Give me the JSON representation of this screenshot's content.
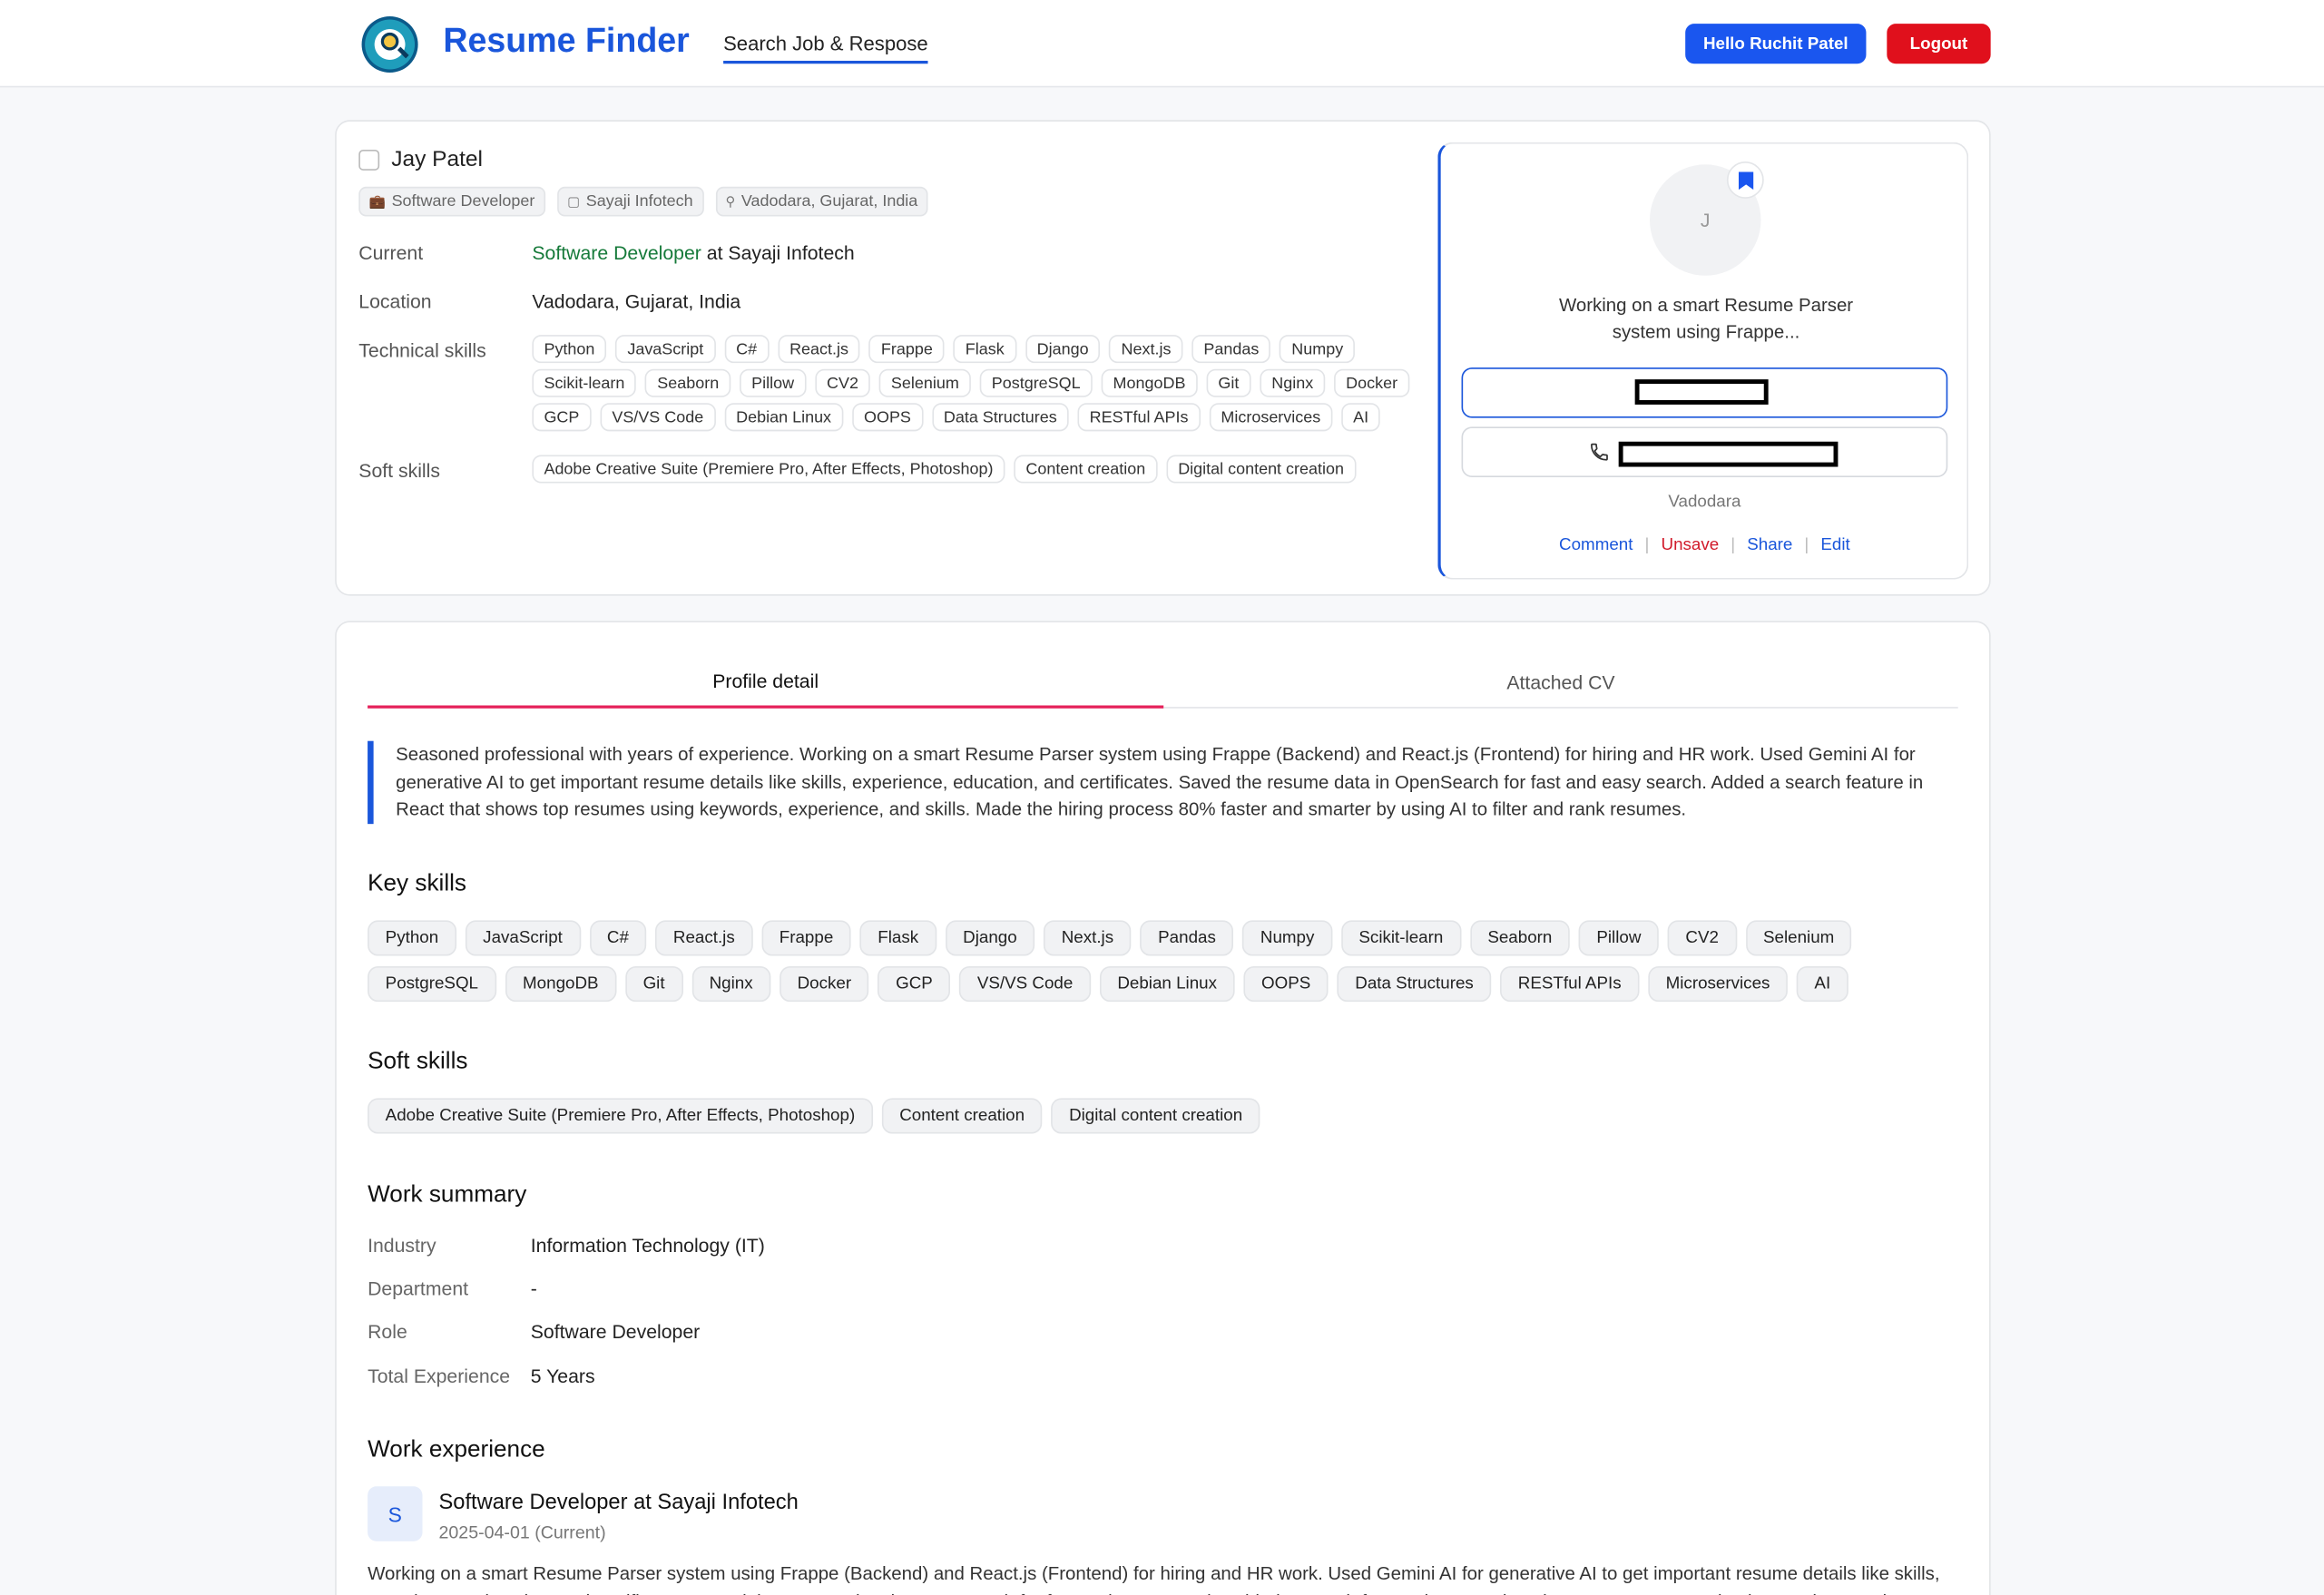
{
  "header": {
    "brand": "Resume Finder",
    "nav_link": "Search Job & Respose",
    "hello_button": "Hello Ruchit Patel",
    "logout_button": "Logout"
  },
  "candidate": {
    "name": "Jay Patel",
    "chips": {
      "role": "Software Developer",
      "company": "Sayaji Infotech",
      "location": "Vadodara, Gujarat, India"
    },
    "current_label": "Current",
    "current_role": "Software Developer",
    "current_sep": " at ",
    "current_company": "Sayaji Infotech",
    "location_label": "Location",
    "location_value": "Vadodara, Gujarat, India",
    "tech_label": "Technical skills",
    "tech_skills": [
      "Python",
      "JavaScript",
      "C#",
      "React.js",
      "Frappe",
      "Flask",
      "Django",
      "Next.js",
      "Pandas",
      "Numpy",
      "Scikit-learn",
      "Seaborn",
      "Pillow",
      "CV2",
      "Selenium",
      "PostgreSQL",
      "MongoDB",
      "Git",
      "Nginx",
      "Docker",
      "GCP",
      "VS/VS Code",
      "Debian Linux",
      "OOPS",
      "Data Structures",
      "RESTful APIs",
      "Microservices",
      "AI"
    ],
    "soft_label": "Soft skills",
    "soft_skills": [
      "Adobe Creative Suite (Premiere Pro, After Effects, Photoshop)",
      "Content creation",
      "Digital content creation"
    ]
  },
  "panel": {
    "avatar_initial": "J",
    "description": "Working on a smart Resume Parser system using Frappe...",
    "city": "Vadodara",
    "actions": {
      "comment": "Comment",
      "unsave": "Unsave",
      "share": "Share",
      "edit": "Edit"
    }
  },
  "tabs": {
    "profile": "Profile detail",
    "cv": "Attached CV"
  },
  "profile": {
    "summary": "Seasoned professional with years of experience. Working on a smart Resume Parser system using Frappe (Backend) and React.js (Frontend) for hiring and HR work. Used Gemini AI for generative AI to get important resume details like skills, experience, education, and certificates. Saved the resume data in OpenSearch for fast and easy search. Added a search feature in React that shows top resumes using keywords, experience, and skills. Made the hiring process 80% faster and smarter by using AI to filter and rank resumes.",
    "key_skills_heading": "Key skills",
    "soft_skills_heading": "Soft skills",
    "work_summary_heading": "Work summary",
    "work_summary": {
      "industry_label": "Industry",
      "industry": "Information Technology (IT)",
      "department_label": "Department",
      "department": "-",
      "role_label": "Role",
      "role": "Software Developer",
      "experience_label": "Total Experience",
      "experience": "5 Years"
    },
    "work_experience_heading": "Work experience",
    "experience": {
      "initial": "S",
      "title": "Software Developer at Sayaji Infotech",
      "date": "2025-04-01 (Current)",
      "description": "Working on a smart Resume Parser system using Frappe (Backend) and React.js (Frontend) for hiring and HR work. Used Gemini AI for generative AI to get important resume details like skills, experience, education, and certificates. Saved the resume data in OpenSearch for fast and easy search. Added a search feature in React that shows top resumes using keywords, experience, and skills."
    }
  },
  "colors": {
    "brand": "#1a56db",
    "logout": "#e0101c",
    "active_tab": "#e5215a",
    "current_role": "#167a3a"
  }
}
